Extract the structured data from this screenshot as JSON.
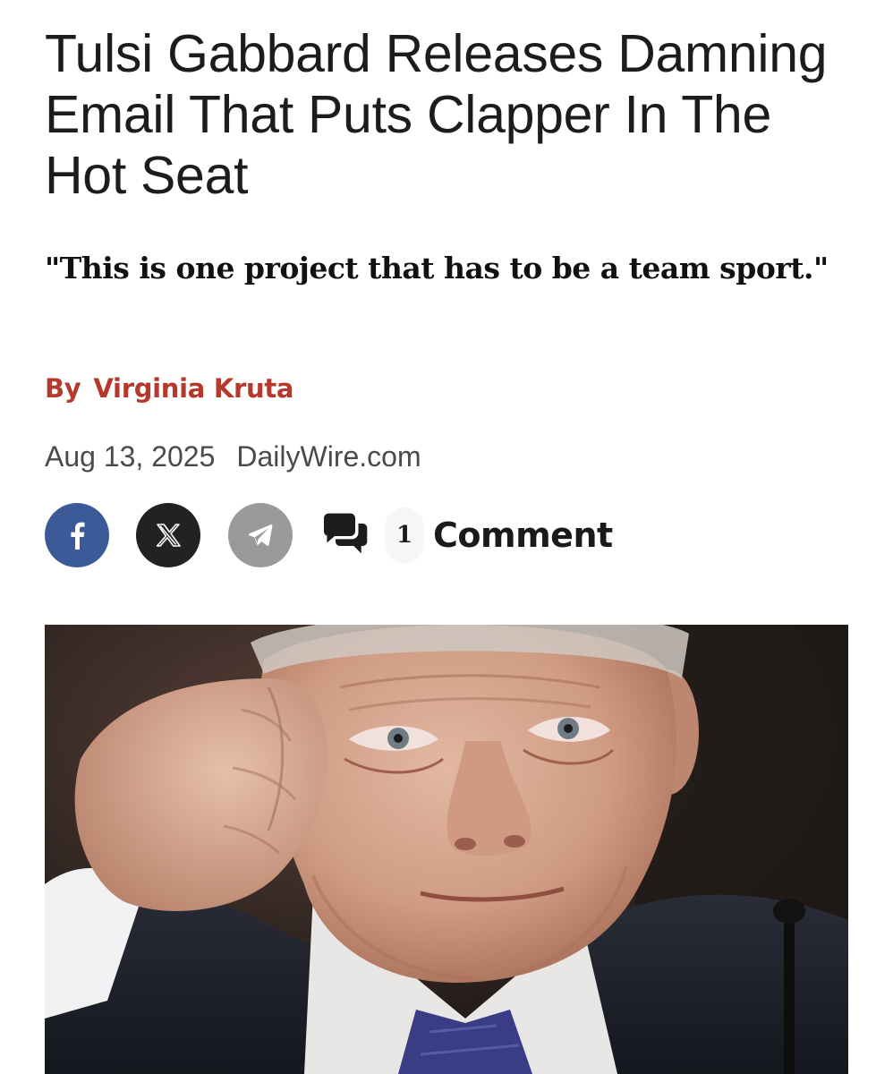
{
  "article": {
    "headline": "Tulsi Gabbard Releases Damning Email That Puts Clapper In The Hot Seat",
    "dek": "\"This is one project that has to be a team sport.\"",
    "byline": {
      "prefix": "By",
      "author": "Virginia Kruta"
    },
    "date": "Aug 13, 2025",
    "source": "DailyWire.com"
  },
  "share": {
    "facebook_icon": "facebook-icon",
    "x_icon": "x-icon",
    "telegram_icon": "telegram-icon",
    "comment_icon": "chat-bubbles-icon",
    "comment_count": "1",
    "comment_label": "Comment"
  },
  "colors": {
    "byline": "#b53a2d",
    "facebook": "#3d5a98",
    "x": "#222222",
    "telegram": "#9a9a9a"
  }
}
